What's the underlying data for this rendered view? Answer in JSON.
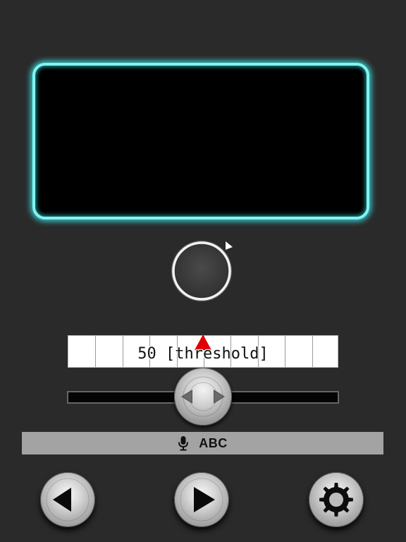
{
  "display": {
    "screen_text": ""
  },
  "tuner": {
    "scale_label": "50 [threshold]",
    "threshold_value": 50,
    "scale_marker_color": "#e00000"
  },
  "slider": {
    "level": 0.5
  },
  "status": {
    "text": "ABC",
    "icon": "microphone-icon"
  },
  "controls": {
    "prev_icon": "triangle-left-icon",
    "play_icon": "triangle-right-icon",
    "settings_icon": "gear-icon"
  },
  "colors": {
    "background": "#2a2a2a",
    "screen_glow": "#7ff4f4",
    "marker": "#e00000"
  }
}
